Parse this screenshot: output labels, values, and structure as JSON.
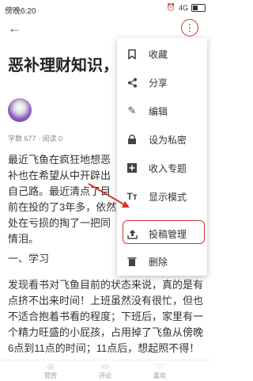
{
  "status": {
    "time": "傍晚6:20",
    "network": "4G"
  },
  "article": {
    "title": "恶补理财知识，开",
    "stats": "字数 677 · 阅读 0",
    "paragraph1": "最近飞鱼在疯狂地想恶补也在希望从中开辟出自己路。最近清点了目前在投的了3年多，依然处在亏损的掏了一把同情泪。",
    "section": "一、学习",
    "paragraph2": "发现看书对飞鱼目前的状态来说，真的是有点挤不出来时间！上班虽然没有很忙，但也不适合抱着书看的程度；下班后，家里有一个精力旺盛的小屁孩，占用掉了飞鱼从傍晚6点到11点的时间；11点后，想起照不得！"
  },
  "menu": [
    {
      "label": "收藏",
      "icon": "bookmark-icon"
    },
    {
      "label": "分享",
      "icon": "share-icon"
    },
    {
      "label": "编辑",
      "icon": "edit-icon"
    },
    {
      "label": "设为私密",
      "icon": "lock-icon"
    },
    {
      "label": "收入专题",
      "icon": "add-icon"
    },
    {
      "label": "显示模式",
      "icon": "text-mode-icon"
    },
    {
      "label": "投稿管理",
      "icon": "upload-icon"
    },
    {
      "label": "删除",
      "icon": "trash-icon"
    }
  ],
  "bottom": {
    "like": "赞赏",
    "comment": "评论",
    "fav": "喜欢"
  }
}
